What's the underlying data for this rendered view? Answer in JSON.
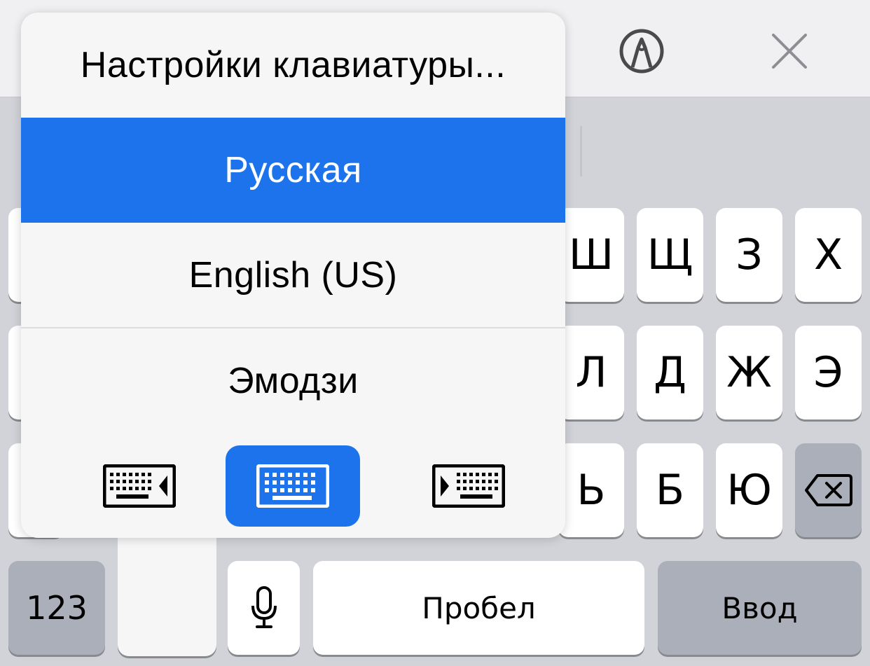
{
  "toolbar": {
    "markup_icon": "pen-circle-icon",
    "close_icon": "close-x-icon"
  },
  "popup": {
    "items": [
      {
        "label": "Настройки клавиатуры..."
      },
      {
        "label": "Русская",
        "selected": true
      },
      {
        "label": "English (US)"
      },
      {
        "label": "Эмодзи"
      }
    ],
    "modes": [
      {
        "icon": "keyboard-left-icon"
      },
      {
        "icon": "keyboard-full-icon",
        "active": true
      },
      {
        "icon": "keyboard-right-icon"
      }
    ]
  },
  "keyboard": {
    "row1": [
      "Ш",
      "Щ",
      "З",
      "Х"
    ],
    "row2": [
      "Л",
      "Д",
      "Ж",
      "Э"
    ],
    "row3": [
      "Ь",
      "Б",
      "Ю"
    ],
    "numbers_key": "123",
    "space_key": "Пробел",
    "return_key": "Ввод",
    "mic_icon": "microphone-icon",
    "delete_icon": "delete-backspace-icon"
  },
  "colors": {
    "accent": "#1c73ec",
    "keyboard_bg": "#d1d3d9",
    "key_bg": "#ffffff",
    "dark_key_bg": "#abafba"
  }
}
